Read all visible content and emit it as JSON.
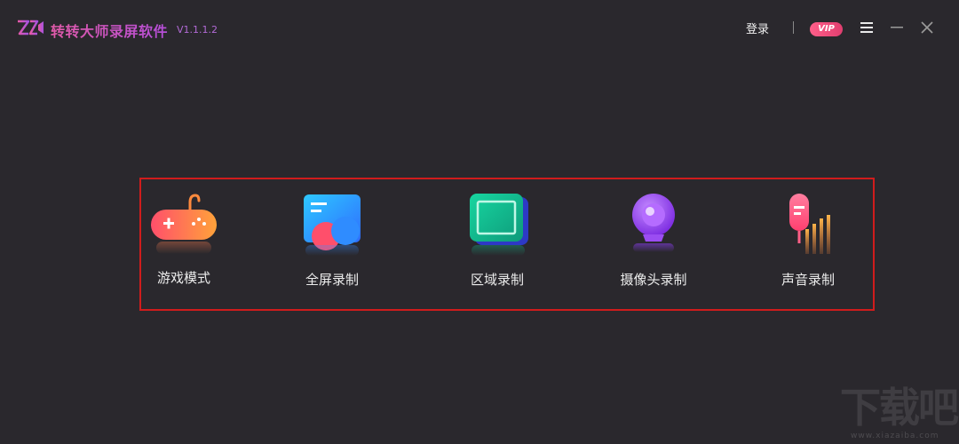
{
  "titlebar": {
    "title": "转转大师录屏软件",
    "version": "V1.1.1.2",
    "login_label": "登录",
    "vip_label": "VIP",
    "logo_icon": "zz-logo-icon",
    "menu_icon": "hamburger-menu-icon",
    "minimize_icon": "minimize-icon",
    "close_icon": "close-icon"
  },
  "modes": [
    {
      "label": "游戏模式",
      "icon": "gamepad-icon"
    },
    {
      "label": "全屏录制",
      "icon": "fullscreen-icon"
    },
    {
      "label": "区域录制",
      "icon": "region-icon"
    },
    {
      "label": "摄像头录制",
      "icon": "camera-icon"
    },
    {
      "label": "声音录制",
      "icon": "microphone-icon"
    }
  ],
  "watermark": {
    "text": "下载吧",
    "sub": "www.xiazaiba.com"
  },
  "colors": {
    "background": "#2a282d",
    "accent_pink": "#e05aa8",
    "accent_purple": "#b44ed8",
    "highlight_border": "#d01c1c",
    "vip_badge": "#ff5f8a"
  }
}
